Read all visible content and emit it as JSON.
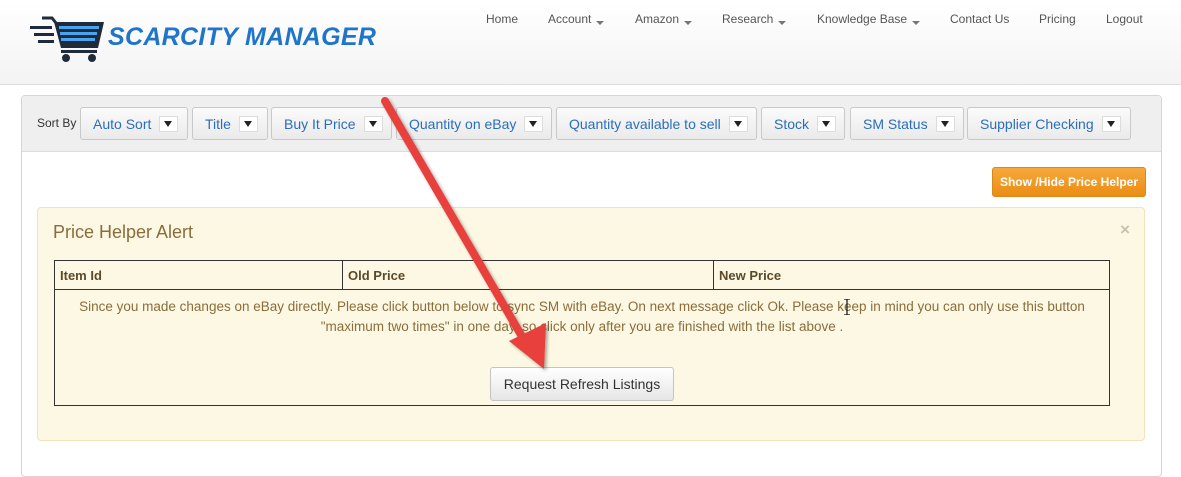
{
  "brand": {
    "name": "SCARCITY MANAGER",
    "colors": {
      "primary": "#1f75c9",
      "cart_dark": "#1f2b3a",
      "accent_orange": "#eb8d14",
      "annotation_arrow": "#e8403c"
    }
  },
  "nav": {
    "items": [
      {
        "label": "Home",
        "dropdown": false
      },
      {
        "label": "Account",
        "dropdown": true
      },
      {
        "label": "Amazon",
        "dropdown": true
      },
      {
        "label": "Research",
        "dropdown": true
      },
      {
        "label": "Knowledge Base",
        "dropdown": true
      },
      {
        "label": "Contact Us",
        "dropdown": false
      },
      {
        "label": "Pricing",
        "dropdown": false
      },
      {
        "label": "Logout",
        "dropdown": false
      }
    ]
  },
  "sortbar": {
    "label": "Sort By",
    "buttons": [
      {
        "label": "Auto Sort"
      },
      {
        "label": "Title"
      },
      {
        "label": "Buy It Price"
      },
      {
        "label": "Quantity on eBay"
      },
      {
        "label": "Quantity available to sell"
      },
      {
        "label": "Stock"
      },
      {
        "label": "SM Status"
      },
      {
        "label": "Supplier Checking"
      }
    ]
  },
  "price_helper_button": "Show /Hide Price Helper",
  "alert": {
    "title": "Price Helper Alert",
    "close": "×",
    "columns": [
      "Item Id",
      "Old Price",
      "New Price"
    ],
    "message_line1": "Since you made changes on eBay directly. Please click button below to sync SM with eBay. On next message click Ok. Please keep in mind you can only use this button",
    "message_line2": "\"maximum two times\" in one day, so click only after you are finished with the list above .",
    "refresh_button": "Request Refresh Listings"
  }
}
